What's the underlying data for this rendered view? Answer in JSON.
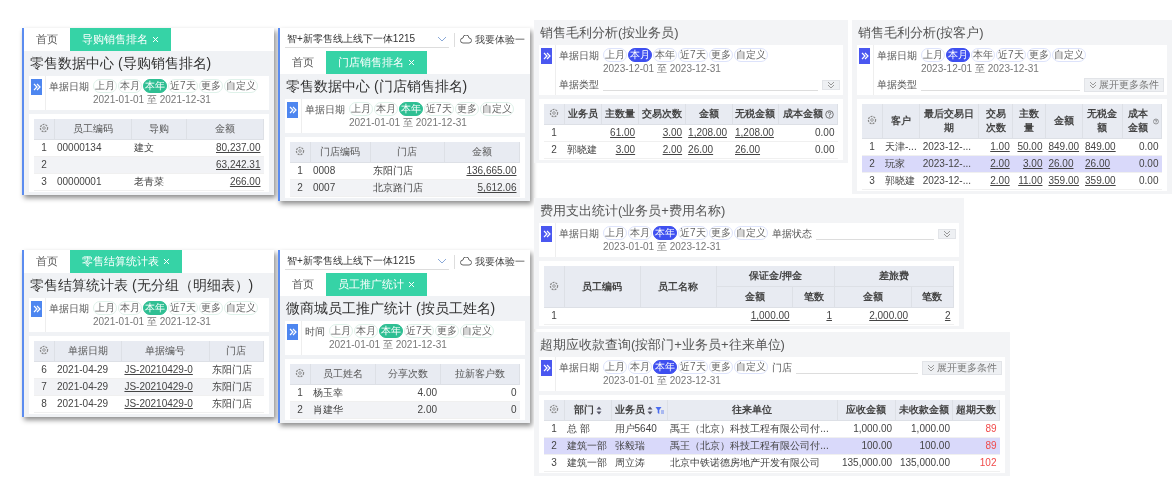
{
  "panels": [
    {
      "kind": "tabbed",
      "tabs": [
        {
          "label": "首页",
          "selected": false
        },
        {
          "label": "导购销售排名",
          "selected": true
        }
      ],
      "title": "零售数据中心 (导购销售排名)",
      "filter": {
        "label": "单据日期",
        "presets": [
          {
            "label": "上月",
            "selected": false
          },
          {
            "label": "本月",
            "selected": false
          },
          {
            "label": "本年",
            "selected": true
          },
          {
            "label": "近7天",
            "selected": false
          },
          {
            "label": "更多",
            "selected": false
          },
          {
            "label": "自定义",
            "selected": false
          }
        ],
        "range": "2021-01-01 至 2021-12-31"
      },
      "table": {
        "columns": [
          {
            "kind": "index"
          },
          {
            "label": "员工编码",
            "kind": "text"
          },
          {
            "label": "导购",
            "kind": "text"
          },
          {
            "label": "金额",
            "kind": "link_number"
          }
        ],
        "rows": [
          {
            "selected": false,
            "cells": [
              "1",
              "00000134",
              "建文",
              "80,237.00"
            ]
          },
          {
            "selected": false,
            "cells": [
              "2",
              "",
              "",
              "63,242.31"
            ]
          },
          {
            "selected": false,
            "cells": [
              "3",
              "00000001",
              "老青菜",
              "266.00"
            ]
          }
        ]
      }
    },
    {
      "kind": "tabbed",
      "top_bar": {
        "project": "智+新零售线上线下一体1215",
        "action": "我要体验一"
      },
      "tabs": [
        {
          "label": "首页",
          "selected": false
        },
        {
          "label": "门店销售排名",
          "selected": true
        }
      ],
      "title": "零售数据中心 (门店销售排名)",
      "filter": {
        "label": "单据日期",
        "presets": [
          {
            "label": "上月",
            "selected": false
          },
          {
            "label": "本月",
            "selected": false
          },
          {
            "label": "本年",
            "selected": true
          },
          {
            "label": "近7天",
            "selected": false
          },
          {
            "label": "更多",
            "selected": false
          },
          {
            "label": "自定义",
            "selected": false
          }
        ],
        "range": "2021-01-01 至 2021-12-31"
      },
      "table": {
        "columns": [
          {
            "kind": "index"
          },
          {
            "label": "门店编码",
            "kind": "text"
          },
          {
            "label": "门店",
            "kind": "text"
          },
          {
            "label": "金额",
            "kind": "link_number"
          }
        ],
        "rows": [
          {
            "selected": false,
            "cells": [
              "1",
              "0008",
              "东阳门店",
              "136,665.00"
            ]
          },
          {
            "selected": false,
            "cells": [
              "2",
              "0007",
              "北京路门店",
              "5,612.06"
            ]
          }
        ]
      }
    },
    {
      "kind": "tabbed",
      "tabs": [
        {
          "label": "首页",
          "selected": false
        },
        {
          "label": "零售结算统计表",
          "selected": true
        }
      ],
      "title": "零售结算统计表 (无分组（明细表）)",
      "filter": {
        "label": "单据日期",
        "presets": [
          {
            "label": "上月",
            "selected": false
          },
          {
            "label": "本月",
            "selected": false
          },
          {
            "label": "本年",
            "selected": true
          },
          {
            "label": "近7天",
            "selected": false
          },
          {
            "label": "更多",
            "selected": false
          },
          {
            "label": "自定义",
            "selected": false
          }
        ],
        "range": "2021-01-01 至 2021-12-31"
      },
      "table": {
        "columns": [
          {
            "kind": "index"
          },
          {
            "label": "单据日期",
            "kind": "text"
          },
          {
            "label": "单据编号",
            "kind": "link"
          },
          {
            "label": "门店",
            "kind": "text"
          }
        ],
        "rows": [
          {
            "selected": false,
            "cells": [
              "6",
              "2021-04-29",
              "JS-20210429-0",
              "东阳门店"
            ]
          },
          {
            "selected": false,
            "cells": [
              "7",
              "2021-04-29",
              "JS-20210429-0",
              "东阳门店"
            ]
          },
          {
            "selected": false,
            "cells": [
              "8",
              "2021-04-29",
              "JS-20210429-0",
              "东阳门店"
            ]
          }
        ]
      }
    },
    {
      "kind": "tabbed",
      "top_bar": {
        "project": "智+新零售线上线下一体1215",
        "action": "我要体验一"
      },
      "tabs": [
        {
          "label": "首页",
          "selected": false
        },
        {
          "label": "员工推广统计",
          "selected": true
        }
      ],
      "title": "微商城员工推广统计 (按员工姓名)",
      "filter": {
        "label": "时间",
        "presets": [
          {
            "label": "上月",
            "selected": false
          },
          {
            "label": "本月",
            "selected": false
          },
          {
            "label": "本年",
            "selected": true
          },
          {
            "label": "近7天",
            "selected": false
          },
          {
            "label": "更多",
            "selected": false
          },
          {
            "label": "自定义",
            "selected": false
          }
        ],
        "range": "2021-01-01 至 2021-12-31"
      },
      "table": {
        "columns": [
          {
            "kind": "index"
          },
          {
            "label": "员工姓名",
            "kind": "text"
          },
          {
            "label": "分享次数",
            "kind": "number"
          },
          {
            "label": "拉新客户数",
            "kind": "number"
          }
        ],
        "rows": [
          {
            "selected": false,
            "cells": [
              "1",
              "杨玉幸",
              "4.00",
              "0"
            ]
          },
          {
            "selected": false,
            "cells": [
              "2",
              "肖建华",
              "2.00",
              "0"
            ]
          }
        ]
      }
    },
    {
      "kind": "report",
      "title": "销售毛利分析(按业务员)",
      "filter": {
        "label": "单据日期",
        "presets": [
          {
            "label": "上月",
            "selected": false
          },
          {
            "label": "本月",
            "selected": true
          },
          {
            "label": "本年",
            "selected": false
          },
          {
            "label": "近7天",
            "selected": false
          },
          {
            "label": "更多",
            "selected": false
          },
          {
            "label": "自定义",
            "selected": false
          }
        ],
        "range": "2023-12-01 至 2023-12-31",
        "field_label": "单据类型",
        "expand_button": true
      },
      "table": {
        "columns": [
          {
            "kind": "index"
          },
          {
            "label": "业务员",
            "kind": "text"
          },
          {
            "label": "主数量",
            "kind": "link_number"
          },
          {
            "label": "交易次数",
            "kind": "link_number"
          },
          {
            "label": "金额",
            "kind": "link"
          },
          {
            "label": "无税金额",
            "kind": "link"
          },
          {
            "label": "成本金额",
            "kind": "number",
            "help": true
          }
        ],
        "rows": [
          {
            "selected": false,
            "cells": [
              "1",
              "",
              "61.00",
              "3.00",
              "1,208.00",
              "1,208.00",
              "0.00"
            ]
          },
          {
            "selected": false,
            "cells": [
              "2",
              "郭晓建",
              "3.00",
              "2.00",
              "26.00",
              "26.00",
              "0.00"
            ]
          }
        ]
      }
    },
    {
      "kind": "report",
      "title": "销售毛利分析(按客户)",
      "filter": {
        "label": "单据日期",
        "presets": [
          {
            "label": "上月",
            "selected": false
          },
          {
            "label": "本月",
            "selected": true
          },
          {
            "label": "本年",
            "selected": false
          },
          {
            "label": "近7天",
            "selected": false
          },
          {
            "label": "更多",
            "selected": false
          },
          {
            "label": "自定义",
            "selected": false
          }
        ],
        "range": "2023-12-01 至 2023-12-31",
        "field_label": "单据类型",
        "expand_button": true,
        "expand_label": "展开更多条件"
      },
      "table": {
        "columns": [
          {
            "kind": "index"
          },
          {
            "label": "客户",
            "kind": "text"
          },
          {
            "label": "最后交易日期",
            "kind": "text"
          },
          {
            "label": "交易次数",
            "kind": "link_number"
          },
          {
            "label": "主数量",
            "kind": "link_number"
          },
          {
            "label": "金额",
            "kind": "link"
          },
          {
            "label": "无税金额",
            "kind": "link"
          },
          {
            "label": "成本金额",
            "kind": "number",
            "help": true
          }
        ],
        "rows": [
          {
            "selected": false,
            "cells": [
              "1",
              "天津-...",
              "2023-12-...",
              "1.00",
              "50.00",
              "849.00",
              "849.00",
              "0.00"
            ]
          },
          {
            "selected": true,
            "cells": [
              "2",
              "玩家",
              "2023-12-...",
              "2.00",
              "3.00",
              "26.00",
              "26.00",
              "0.00"
            ]
          },
          {
            "selected": false,
            "cells": [
              "3",
              "郭晓建",
              "2023-12-...",
              "2.00",
              "11.00",
              "359.00",
              "359.00",
              "0.00"
            ]
          }
        ]
      }
    },
    {
      "kind": "report",
      "title": "费用支出统计(业务员+费用名称)",
      "filter": {
        "label": "单据日期",
        "presets": [
          {
            "label": "上月",
            "selected": false
          },
          {
            "label": "本月",
            "selected": false
          },
          {
            "label": "本年",
            "selected": true
          },
          {
            "label": "近7天",
            "selected": false
          },
          {
            "label": "更多",
            "selected": false
          },
          {
            "label": "自定义",
            "selected": false
          }
        ],
        "range": "2023-01-01 至 2023-12-31",
        "field_label": "单据状态",
        "expand_button": true
      },
      "table": {
        "columns": [
          {
            "kind": "index"
          },
          {
            "label": "员工编码",
            "kind": "text"
          },
          {
            "label": "员工名称",
            "kind": "text"
          },
          {
            "label": "保证金/押金",
            "colspan": 2,
            "children": [
              {
                "label": "金额",
                "kind": "link_number"
              },
              {
                "label": "笔数",
                "kind": "link_number"
              }
            ]
          },
          {
            "label": "差旅费",
            "colspan": 2,
            "children": [
              {
                "label": "金额",
                "kind": "link_number"
              },
              {
                "label": "笔数",
                "kind": "link_number"
              }
            ]
          }
        ],
        "rows": [
          {
            "selected": false,
            "cells": [
              "1",
              "",
              "",
              "1,000.00",
              "1",
              "2,000.00",
              "2"
            ]
          }
        ]
      }
    },
    {
      "kind": "report",
      "title": "超期应收款查询(按部门+业务员+往来单位)",
      "filter": {
        "label": "单据日期",
        "presets": [
          {
            "label": "上月",
            "selected": false
          },
          {
            "label": "本月",
            "selected": false
          },
          {
            "label": "本年",
            "selected": true
          },
          {
            "label": "近7天",
            "selected": false
          },
          {
            "label": "更多",
            "selected": false
          },
          {
            "label": "自定义",
            "selected": false
          }
        ],
        "range": "2023-01-01 至 2023-12-31",
        "field_label": "门店",
        "expand_button": true,
        "expand_label": "展开更多条件"
      },
      "table": {
        "columns": [
          {
            "kind": "index"
          },
          {
            "label": "部门",
            "kind": "text",
            "sortable": true
          },
          {
            "label": "业务员",
            "kind": "text",
            "sortable": true,
            "filtered": true
          },
          {
            "label": "往来单位",
            "kind": "text"
          },
          {
            "label": "应收金额",
            "kind": "number"
          },
          {
            "label": "未收款金额",
            "kind": "number"
          },
          {
            "label": "超期天数",
            "kind": "alert"
          }
        ],
        "rows": [
          {
            "selected": false,
            "cells": [
              "1",
              "总 部",
              "用户5640",
              "禹王（北京）科技工程有限公司付...",
              "1,000.00",
              "1,000.00",
              "89"
            ]
          },
          {
            "selected": true,
            "cells": [
              "2",
              "建筑一部",
              "张毅瑞",
              "禹王（北京）科技工程有限公司付...",
              "100.00",
              "100.00",
              "89"
            ]
          },
          {
            "selected": false,
            "cells": [
              "3",
              "建筑一部",
              "周立涛",
              "北京中铁诺德房地产开发有限公司",
              "135,000.00",
              "135,000.00",
              "102"
            ]
          }
        ]
      }
    }
  ]
}
